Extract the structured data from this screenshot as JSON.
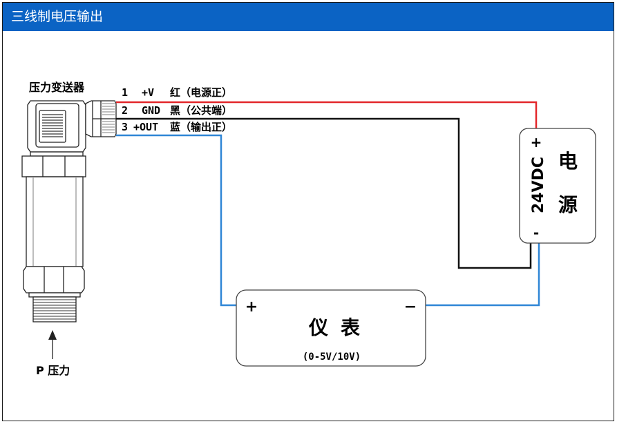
{
  "window": {
    "title": "三线制电压输出"
  },
  "sensor": {
    "label": "压力变送器"
  },
  "wires": [
    {
      "pin": "1",
      "signal": "+V",
      "desc": "红（电源正）",
      "color": "#e3262a"
    },
    {
      "pin": "2",
      "signal": "GND",
      "desc": "黑（公共端）",
      "color": "#111111"
    },
    {
      "pin": "3",
      "signal": "+OUT",
      "desc": "蓝（输出正）",
      "color": "#2f86d6"
    }
  ],
  "power": {
    "voltage": "24VDC",
    "char1": "电",
    "char2": "源",
    "plus": "+",
    "minus": "-"
  },
  "meter": {
    "char1": "仪",
    "char2": "表",
    "range": "(0-5V/10V)",
    "plus": "+",
    "minus": "−"
  },
  "pressure": {
    "label": "P  压力"
  }
}
